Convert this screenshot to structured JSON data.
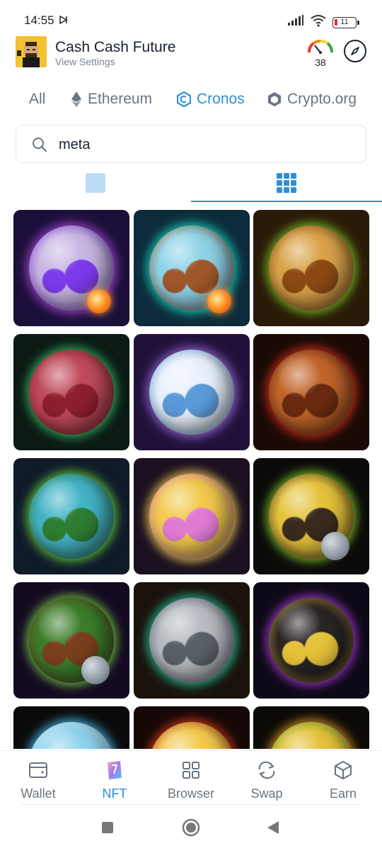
{
  "status_bar": {
    "time": "14:55",
    "battery": "11"
  },
  "header": {
    "wallet_name": "Cash Cash Future",
    "subtitle": "View Settings",
    "gauge_value": "38"
  },
  "chain_tabs": [
    {
      "label": "All",
      "icon": "none",
      "active": false
    },
    {
      "label": "Ethereum",
      "icon": "ethereum-icon",
      "active": false
    },
    {
      "label": "Cronos",
      "icon": "cronos-icon",
      "active": true
    },
    {
      "label": "Crypto.org",
      "icon": "crypto-org-icon",
      "active": false
    }
  ],
  "search": {
    "value": "meta",
    "placeholder": ""
  },
  "view_toggle": {
    "selected": "grid"
  },
  "nfts": [
    {
      "palette": [
        "#c8b6e2",
        "#7c3aed",
        "#1b0f3a"
      ],
      "glow": "#b04ad6",
      "accent": "comet"
    },
    {
      "palette": [
        "#8fd3e8",
        "#a0582b",
        "#0d2b3a"
      ],
      "glow": "#14e0c0",
      "accent": "comet"
    },
    {
      "palette": [
        "#d9a24a",
        "#8c4a12",
        "#2a1a08"
      ],
      "glow": "#7bcf2a",
      "accent": "none"
    },
    {
      "palette": [
        "#c04a5a",
        "#8e1f2f",
        "#0b1a14"
      ],
      "glow": "#3bbf6a",
      "accent": "none"
    },
    {
      "palette": [
        "#e8f1fb",
        "#5b9ad8",
        "#21113a"
      ],
      "glow": "#a071e0",
      "accent": "none"
    },
    {
      "palette": [
        "#c0642a",
        "#6a2a10",
        "#1a0a06"
      ],
      "glow": "#e0321e",
      "accent": "none"
    },
    {
      "palette": [
        "#44b3c7",
        "#2e7d32",
        "#0f1a2a"
      ],
      "glow": "#6ad33a",
      "accent": "none"
    },
    {
      "palette": [
        "#f2c94c",
        "#e07bd4",
        "#1a1020"
      ],
      "glow": "#ffd45a",
      "accent": "none"
    },
    {
      "palette": [
        "#e5c23a",
        "#3a2a1e",
        "#0a0a0a"
      ],
      "glow": "#88d22a",
      "accent": "moon"
    },
    {
      "palette": [
        "#3b7d2a",
        "#7a3f1e",
        "#140a22"
      ],
      "glow": "#7ad64a",
      "accent": "moon"
    },
    {
      "palette": [
        "#b7bcc2",
        "#5a6068",
        "#1a120c"
      ],
      "glow": "#22c7a0",
      "accent": "none"
    },
    {
      "palette": [
        "#2a2424",
        "#e5c23a",
        "#0c0a16"
      ],
      "glow": "#b23be0",
      "accent": "none"
    },
    {
      "palette": [
        "#8fd3ef",
        "#e8f4fb",
        "#0a0a0a"
      ],
      "glow": "#4fc3f7",
      "accent": "none"
    },
    {
      "palette": [
        "#f2c94c",
        "#b23a1a",
        "#150806"
      ],
      "glow": "#e03a1e",
      "accent": "none"
    },
    {
      "palette": [
        "#e5c23a",
        "#5aa83a",
        "#0c0a06"
      ],
      "glow": "#e59a2a",
      "accent": "none"
    }
  ],
  "bottom_nav": [
    {
      "label": "Wallet",
      "icon": "wallet-icon",
      "active": false
    },
    {
      "label": "NFT",
      "icon": "nft-icon",
      "active": true
    },
    {
      "label": "Browser",
      "icon": "browser-icon",
      "active": false
    },
    {
      "label": "Swap",
      "icon": "swap-icon",
      "active": false
    },
    {
      "label": "Earn",
      "icon": "earn-icon",
      "active": false
    }
  ],
  "colors": {
    "accent": "#2e8fd9",
    "muted": "#6b7480",
    "text": "#1a2230"
  }
}
